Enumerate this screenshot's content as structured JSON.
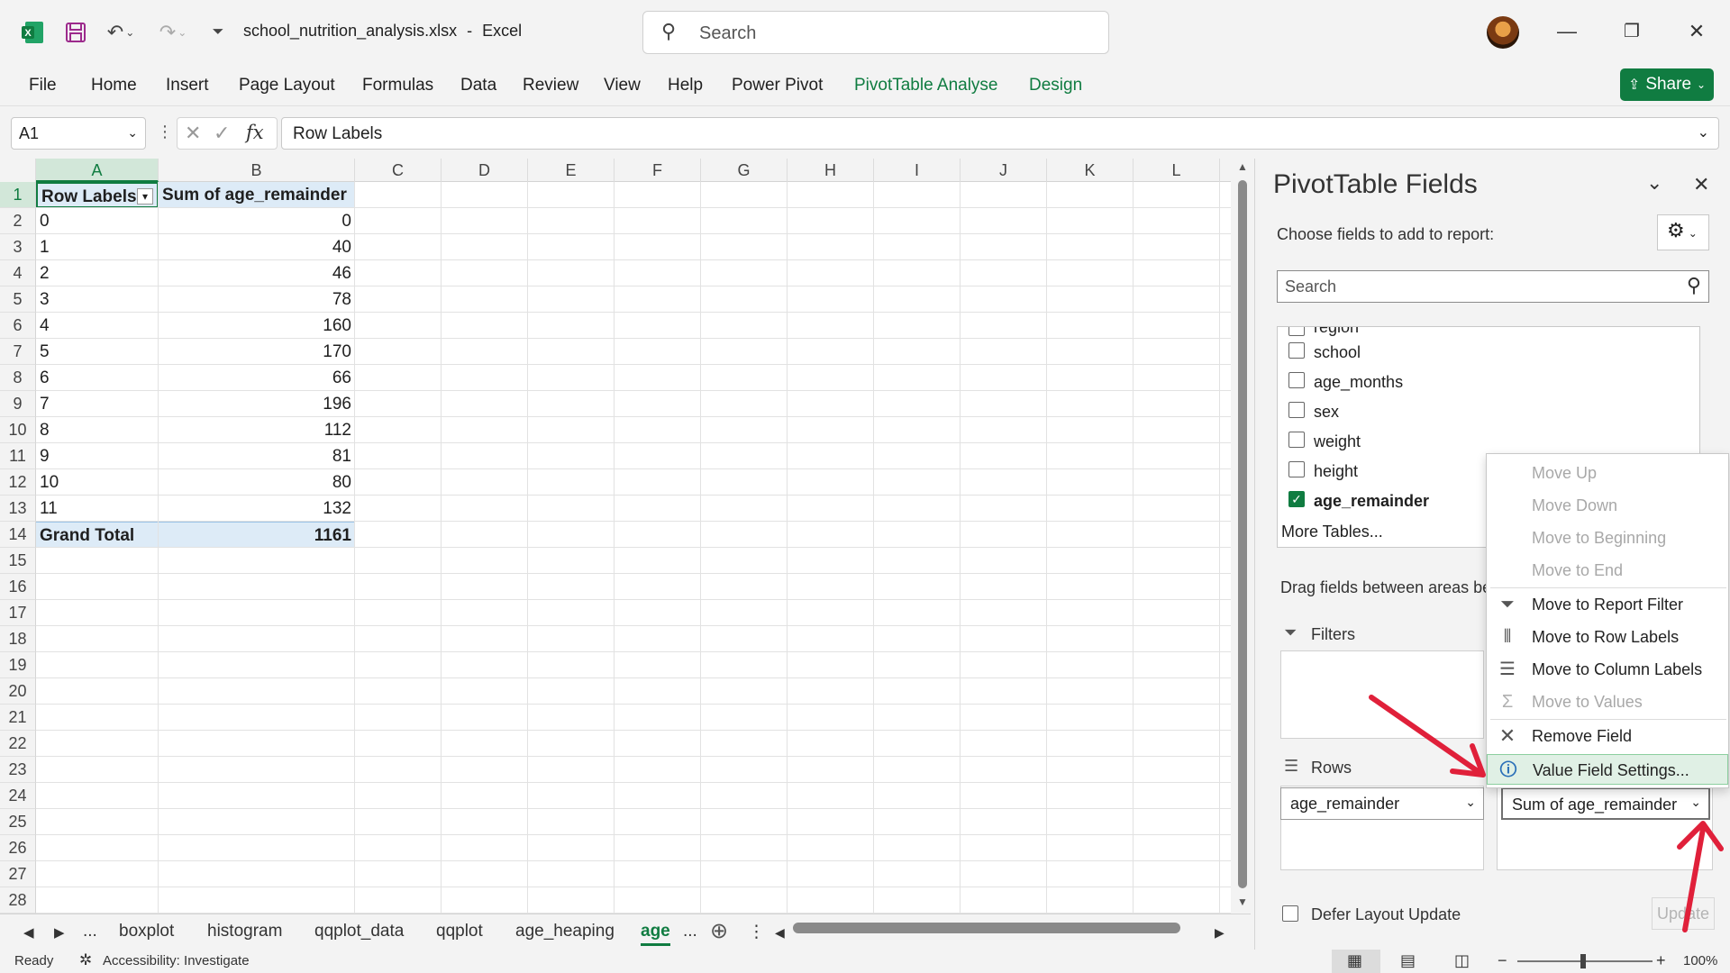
{
  "window": {
    "filename": "school_nutrition_analysis.xlsx",
    "app_separator": "-",
    "app": "Excel",
    "search_placeholder": "Search"
  },
  "ribbon": {
    "tabs": [
      "File",
      "Home",
      "Insert",
      "Page Layout",
      "Formulas",
      "Data",
      "Review",
      "View",
      "Help",
      "Power Pivot",
      "PivotTable Analyse",
      "Design"
    ],
    "share_label": "Share"
  },
  "formula": {
    "name_box": "A1",
    "fx": "fx",
    "content": "Row Labels"
  },
  "grid": {
    "columns": [
      "A",
      "B",
      "C",
      "D",
      "E",
      "F",
      "G",
      "H",
      "I",
      "J",
      "K",
      "L"
    ],
    "rows": [
      "1",
      "2",
      "3",
      "4",
      "5",
      "6",
      "7",
      "8",
      "9",
      "10",
      "11",
      "12",
      "13",
      "14",
      "15",
      "16",
      "17",
      "18",
      "19",
      "20",
      "21",
      "22",
      "23",
      "24",
      "25",
      "26",
      "27",
      "28"
    ],
    "header_a": "Row Labels",
    "header_b": "Sum of age_remainder",
    "labels": [
      "0",
      "1",
      "2",
      "3",
      "4",
      "5",
      "6",
      "7",
      "8",
      "9",
      "10",
      "11"
    ],
    "values": [
      "0",
      "40",
      "46",
      "78",
      "160",
      "170",
      "66",
      "196",
      "112",
      "81",
      "80",
      "132"
    ],
    "total_label": "Grand Total",
    "total_value": "1161"
  },
  "sheets": {
    "ellipsis": "...",
    "tabs": [
      "boxplot",
      "histogram",
      "qqplot_data",
      "qqplot",
      "age_heaping",
      "age"
    ],
    "more": "..."
  },
  "status": {
    "ready": "Ready",
    "accessibility": "Accessibility: Investigate",
    "zoom": "100%"
  },
  "pivot": {
    "title": "PivotTable Fields",
    "choose": "Choose fields to add to report:",
    "search_placeholder": "Search",
    "fields": [
      {
        "name": "region",
        "checked": false
      },
      {
        "name": "school",
        "checked": false
      },
      {
        "name": "age_months",
        "checked": false
      },
      {
        "name": "sex",
        "checked": false
      },
      {
        "name": "weight",
        "checked": false
      },
      {
        "name": "height",
        "checked": false
      },
      {
        "name": "age_remainder",
        "checked": true
      }
    ],
    "more_tables": "More Tables...",
    "drag_text": "Drag fields between areas be",
    "filters": "Filters",
    "rows": "Rows",
    "rows_field": "age_remainder",
    "values_field": "Sum of age_remainder",
    "defer": "Defer Layout Update",
    "update": "Update"
  },
  "context_menu": {
    "items": [
      "Move Up",
      "Move Down",
      "Move to Beginning",
      "Move to End",
      "Move to Report Filter",
      "Move to Row Labels",
      "Move to Column Labels",
      "Move to Values",
      "Remove Field",
      "Value Field Settings..."
    ]
  },
  "colors": {
    "accent_green": "#107c41",
    "arrow_red": "#e0203a",
    "pivot_header_fill": "#ddebf7"
  }
}
